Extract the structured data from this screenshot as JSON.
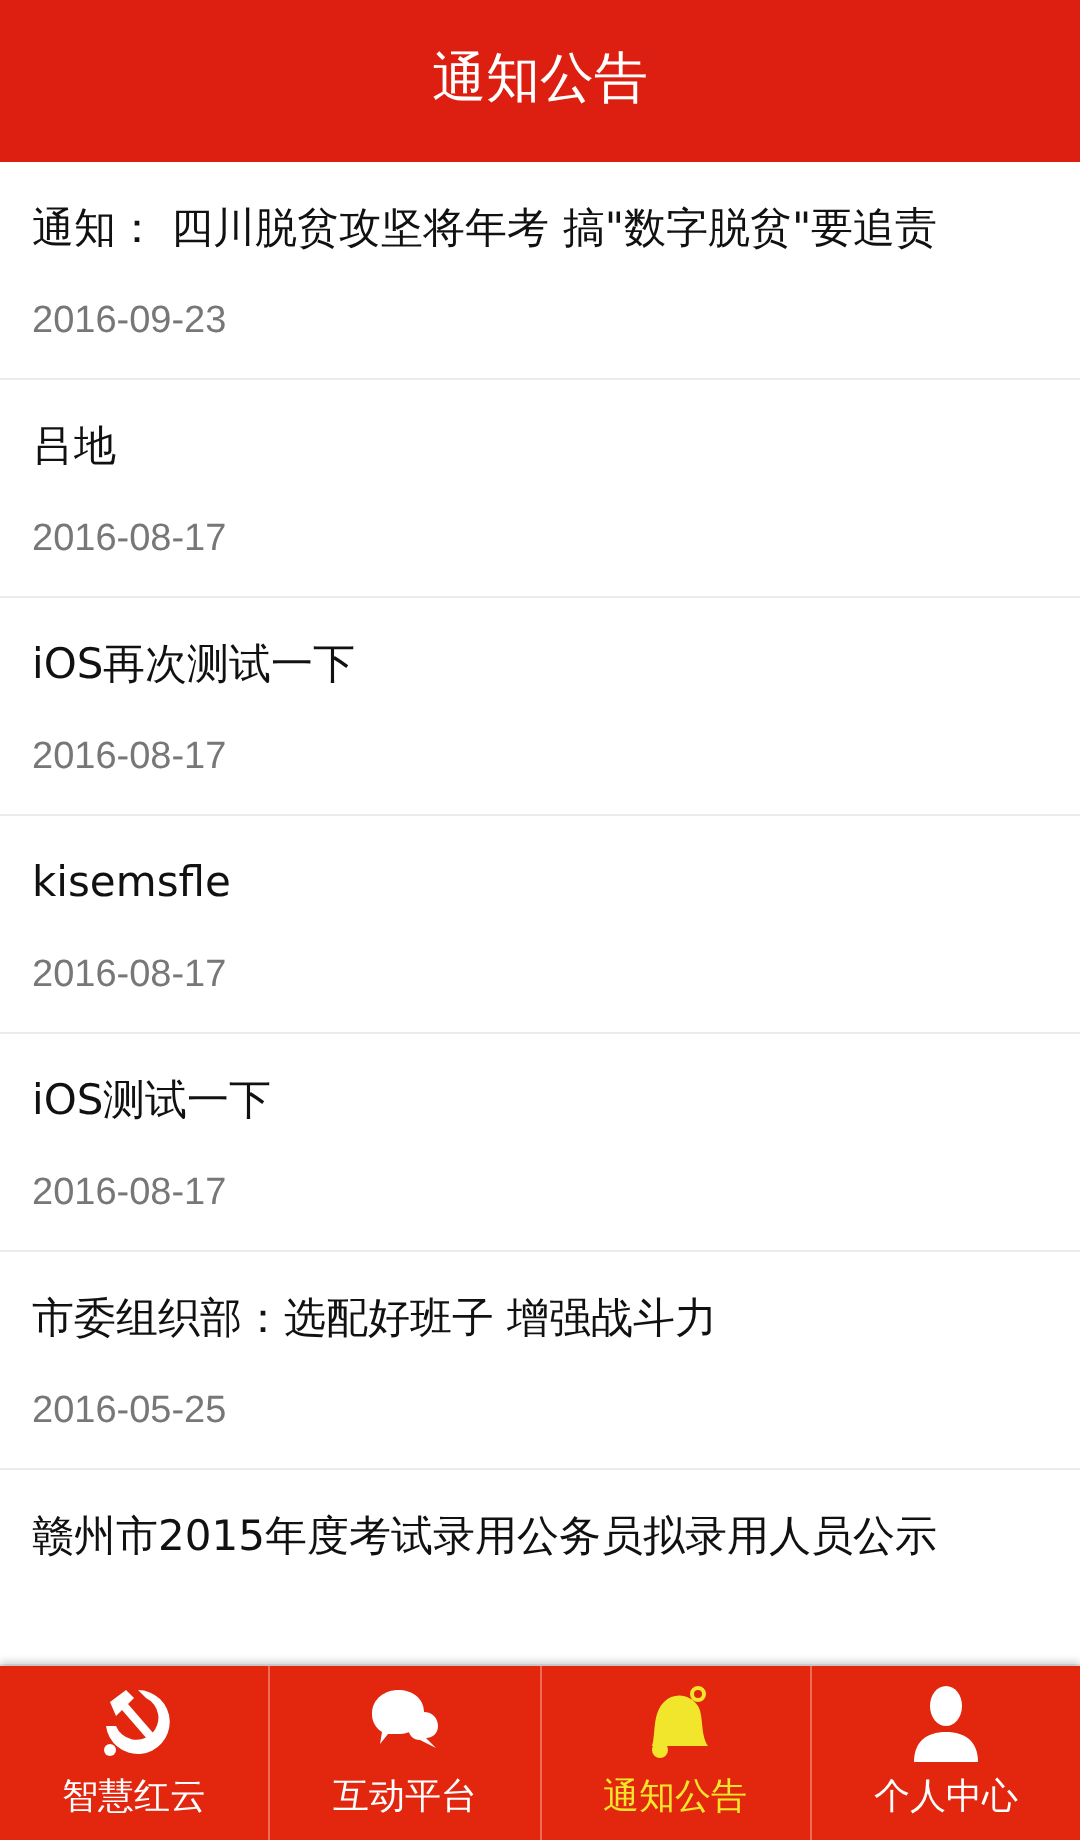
{
  "header": {
    "title": "通知公告"
  },
  "notices": [
    {
      "title": "通知：  四川脱贫攻坚将年考  搞\"数字脱贫\"要追责",
      "date": "2016-09-23"
    },
    {
      "title": "吕地",
      "date": "2016-08-17"
    },
    {
      "title": "iOS再次测试一下",
      "date": "2016-08-17"
    },
    {
      "title": "kisemsfle",
      "date": "2016-08-17"
    },
    {
      "title": "iOS测试一下",
      "date": "2016-08-17"
    },
    {
      "title": "市委组织部：选配好班子 增强战斗力",
      "date": "2016-05-25"
    },
    {
      "title": "赣州市2015年度考试录用公务员拟录用人员公示"
    }
  ],
  "tab_bar": [
    {
      "kind": "emblem",
      "label": "智慧红云",
      "selected": false
    },
    {
      "kind": "chat",
      "label": "互动平台",
      "selected": false
    },
    {
      "kind": "bell",
      "label": "通知公告",
      "selected": true
    },
    {
      "kind": "person",
      "label": "个人中心",
      "selected": false
    }
  ]
}
